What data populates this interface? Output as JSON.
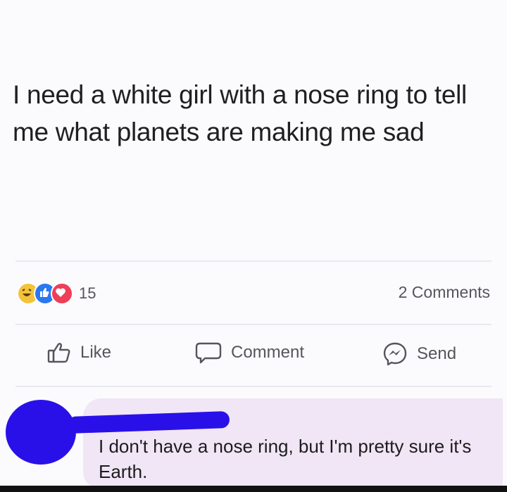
{
  "post": {
    "text": "I need a white girl with a nose ring to tell me what planets are making me sad"
  },
  "stats": {
    "reactions_count": "15",
    "reaction_icons": [
      "haha-icon",
      "like-icon",
      "love-icon"
    ],
    "comments_count": "2 Comments"
  },
  "actions": {
    "like": "Like",
    "comment": "Comment",
    "send": "Send"
  },
  "comment": {
    "text": "I don't have a nose ring, but I'm pretty sure it's Earth."
  },
  "colors": {
    "redaction": "#2a10e8",
    "comment_bubble": "#f1e6f5",
    "text_muted": "#55555c"
  }
}
